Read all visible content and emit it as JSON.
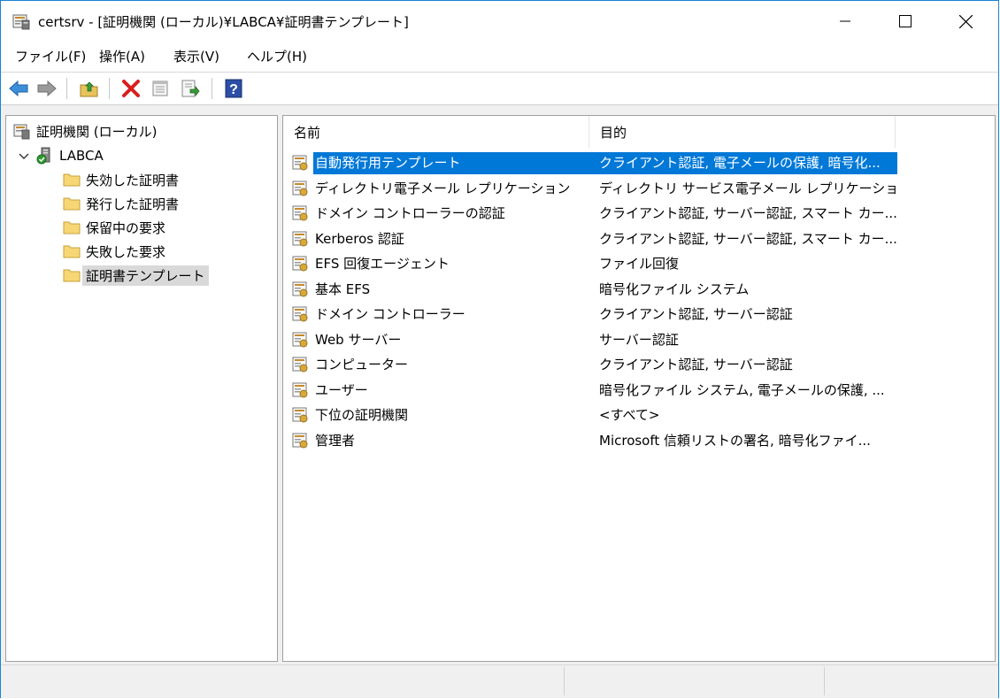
{
  "window": {
    "title": "certsrv - [証明機関 (ローカル)¥LABCA¥証明書テンプレート]",
    "minimize_icon": "minimize-icon",
    "maximize_icon": "maximize-icon",
    "close_icon": "close-icon"
  },
  "menu": [
    "ファイル(F)",
    "操作(A)",
    "表示(V)",
    "ヘルプ(H)"
  ],
  "toolbar": {
    "buttons": [
      "back-arrow-icon",
      "forward-arrow-icon",
      "up-folder-icon",
      "delete-icon",
      "properties-icon",
      "export-list-icon",
      "help-icon"
    ]
  },
  "tree": {
    "root": "証明機関 (ローカル)",
    "ca": "LABCA",
    "children": [
      "失効した証明書",
      "発行した証明書",
      "保留中の要求",
      "失敗した要求",
      "証明書テンプレート"
    ],
    "selected_index": 4
  },
  "list": {
    "columns": [
      "名前",
      "目的"
    ],
    "rows": [
      {
        "name": "自動発行用テンプレート",
        "purpose": "クライアント認証, 電子メールの保護, 暗号化..."
      },
      {
        "name": "ディレクトリ電子メール レプリケーション",
        "purpose": "ディレクトリ サービス電子メール レプリケーション"
      },
      {
        "name": "ドメイン コントローラーの認証",
        "purpose": "クライアント認証, サーバー認証, スマート カー..."
      },
      {
        "name": "Kerberos 認証",
        "purpose": "クライアント認証, サーバー認証, スマート カー..."
      },
      {
        "name": "EFS 回復エージェント",
        "purpose": "ファイル回復"
      },
      {
        "name": "基本 EFS",
        "purpose": "暗号化ファイル システム"
      },
      {
        "name": "ドメイン コントローラー",
        "purpose": "クライアント認証, サーバー認証"
      },
      {
        "name": "Web サーバー",
        "purpose": "サーバー認証"
      },
      {
        "name": "コンピューター",
        "purpose": "クライアント認証, サーバー認証"
      },
      {
        "name": "ユーザー",
        "purpose": "暗号化ファイル システム, 電子メールの保護, ..."
      },
      {
        "name": "下位の証明機関",
        "purpose": "<すべて>"
      },
      {
        "name": "管理者",
        "purpose": "Microsoft 信頼リストの署名, 暗号化ファイ..."
      }
    ],
    "selected_index": 0
  },
  "colors": {
    "selection": "#0078d7",
    "window_border": "#1883d7",
    "tree_selection": "#d9d9d9"
  }
}
